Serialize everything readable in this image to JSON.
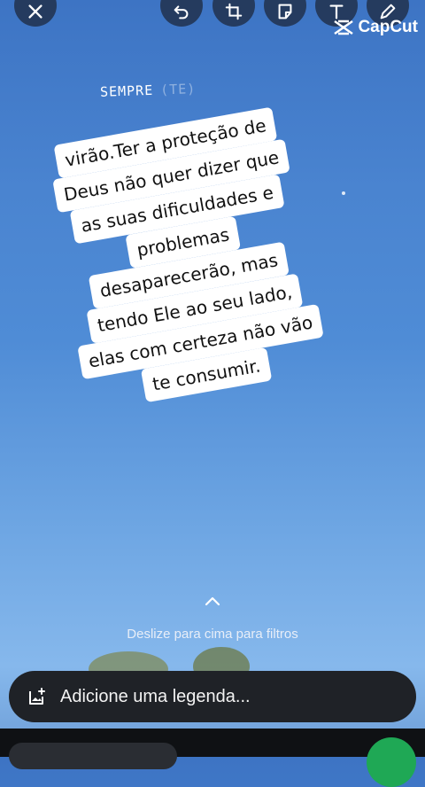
{
  "toolbar": {
    "close_icon": "close-icon",
    "tools": [
      "undo-icon",
      "crop-rotate-icon",
      "sticker-icon",
      "text-icon",
      "pen-icon"
    ]
  },
  "watermark": {
    "label": "CapCut"
  },
  "overlay_text": {
    "sempre": "SEMPRE",
    "faint": "(TE)"
  },
  "quote": {
    "lines": [
      "virão.Ter a proteção de",
      "Deus não quer dizer que",
      "as suas dificuldades e",
      "problemas",
      "desaparecerão, mas",
      "tendo Ele ao seu lado,",
      "elas com certeza não vão",
      "te consumir."
    ]
  },
  "filters_hint": "Deslize para cima para filtros",
  "caption": {
    "placeholder": "Adicione uma legenda..."
  },
  "colors": {
    "send_button": "#1fa855",
    "caption_bar": "#1f2227",
    "sky": "#4f8cd6"
  }
}
